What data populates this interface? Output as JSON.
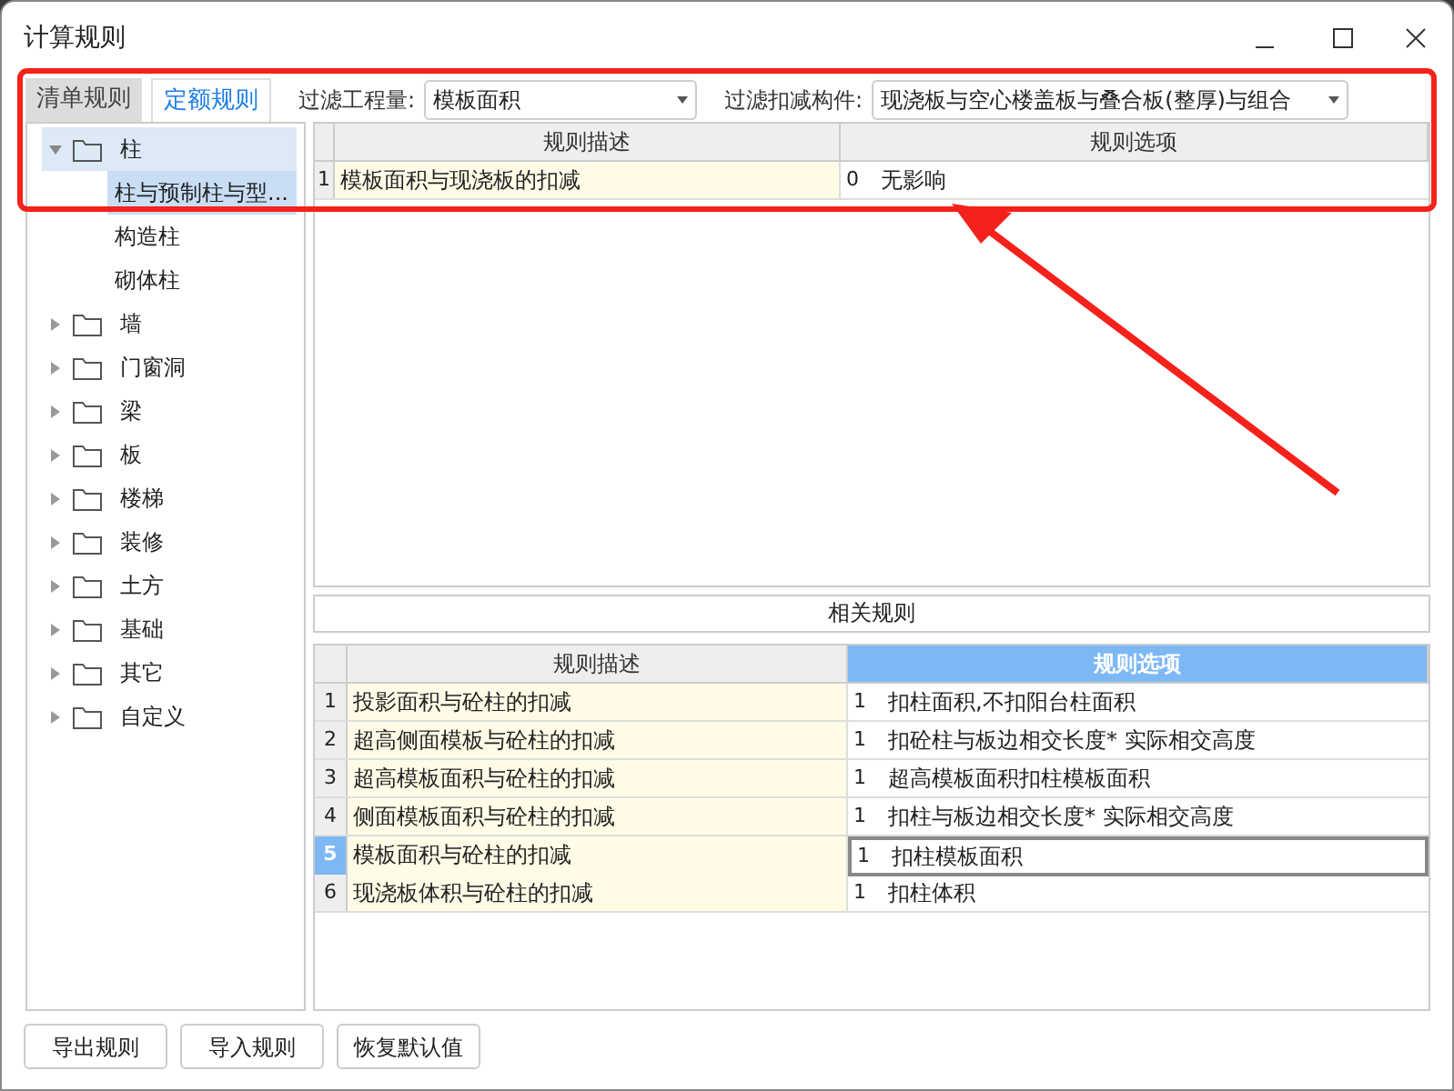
{
  "window": {
    "title": "计算规则"
  },
  "tabs": [
    {
      "label": "清单规则",
      "selected": false
    },
    {
      "label": "定额规则",
      "selected": true
    }
  ],
  "filters": [
    {
      "label": "过滤工程量:",
      "value": "模板面积"
    },
    {
      "label": "过滤扣减构件:",
      "value": "现浇板与空心楼盖板与叠合板(整厚)与组合"
    }
  ],
  "tree": [
    {
      "label": "柱",
      "expanded": true,
      "hovered": true,
      "selected": false,
      "children": [
        {
          "label": "柱与预制柱与型...",
          "selected": true
        },
        {
          "label": "构造柱",
          "selected": false
        },
        {
          "label": "砌体柱",
          "selected": false
        }
      ]
    },
    {
      "label": "墙",
      "expanded": false,
      "hovered": false,
      "selected": false
    },
    {
      "label": "门窗洞",
      "expanded": false,
      "hovered": false,
      "selected": false
    },
    {
      "label": "梁",
      "expanded": false,
      "hovered": false,
      "selected": false
    },
    {
      "label": "板",
      "expanded": false,
      "hovered": false,
      "selected": false
    },
    {
      "label": "楼梯",
      "expanded": false,
      "hovered": false,
      "selected": false
    },
    {
      "label": "装修",
      "expanded": false,
      "hovered": false,
      "selected": false
    },
    {
      "label": "土方",
      "expanded": false,
      "hovered": false,
      "selected": false
    },
    {
      "label": "基础",
      "expanded": false,
      "hovered": false,
      "selected": false
    },
    {
      "label": "其它",
      "expanded": false,
      "hovered": false,
      "selected": false
    },
    {
      "label": "自定义",
      "expanded": false,
      "hovered": false,
      "selected": false
    }
  ],
  "rules_table": {
    "columns": [
      {
        "label": "规则描述",
        "selected": false
      },
      {
        "label": "规则选项",
        "selected": false
      }
    ],
    "rows": [
      {
        "number": "1",
        "description": "模板面积与现浇板的扣减",
        "code": "0",
        "option": "无影响",
        "selected": false
      }
    ]
  },
  "related_rules": {
    "title": "相关规则",
    "columns": [
      {
        "label": "规则描述",
        "selected": false
      },
      {
        "label": "规则选项",
        "selected": true
      }
    ],
    "rows": [
      {
        "number": "1",
        "description": "投影面积与砼柱的扣减",
        "code": "1",
        "option": "扣柱面积,不扣阳台柱面积",
        "selected": false
      },
      {
        "number": "2",
        "description": "超高侧面模板与砼柱的扣减",
        "code": "1",
        "option": "扣砼柱与板边相交长度* 实际相交高度",
        "selected": false
      },
      {
        "number": "3",
        "description": "超高模板面积与砼柱的扣减",
        "code": "1",
        "option": "超高模板面积扣柱模板面积",
        "selected": false
      },
      {
        "number": "4",
        "description": "侧面模板面积与砼柱的扣减",
        "code": "1",
        "option": "扣柱与板边相交长度* 实际相交高度",
        "selected": false
      },
      {
        "number": "5",
        "description": "模板面积与砼柱的扣减",
        "code": "1",
        "option": "扣柱模板面积",
        "selected": true
      },
      {
        "number": "6",
        "description": "现浇板体积与砼柱的扣减",
        "code": "1",
        "option": "扣柱体积",
        "selected": false
      }
    ]
  },
  "buttons": [
    "导出规则",
    "导入规则",
    "恢复默认值"
  ]
}
